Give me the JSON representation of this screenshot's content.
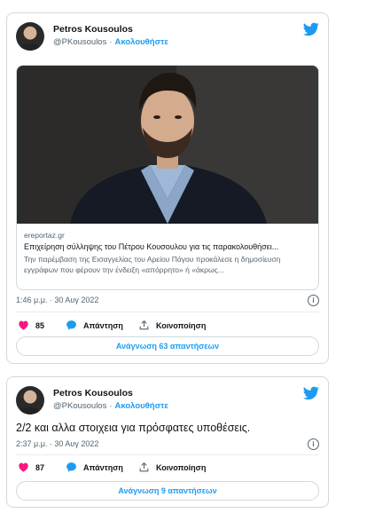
{
  "tweets": [
    {
      "display_name": "Petros Kousoulos",
      "handle": "@PKousoulos",
      "separator": "·",
      "follow_label": "Ακολουθήστε",
      "card": {
        "domain": "ereportaz.gr",
        "title": "Επιχείρηση σύλληψης του Πέτρου Κουσουλου για τις παρακολουθήσει...",
        "description": "Την παρέμβαση της Εισαγγελίας του Αρείου Πάγου προκάλεσε η δημοσίευση εγγράφων που φέρουν την ένδειξη «απόρρητο» ή «άκρως..."
      },
      "timestamp": "1:46 μ.μ. · 30 Αυγ 2022",
      "info_symbol": "i",
      "likes": "85",
      "reply_label": "Απάντηση",
      "share_label": "Κοινοποίηση",
      "read_replies_label": "Ανάγνωση 63 απαντήσεων"
    },
    {
      "display_name": "Petros Kousoulos",
      "handle": "@PKousoulos",
      "separator": "·",
      "follow_label": "Ακολουθήστε",
      "text": "2/2 και αλλα στοιχεια για πρόσφατες υποθέσεις.",
      "timestamp": "2:37 μ.μ. · 30 Αυγ 2022",
      "info_symbol": "i",
      "likes": "87",
      "reply_label": "Απάντηση",
      "share_label": "Κοινοποίηση",
      "read_replies_label": "Ανάγνωση 9 απαντήσεων"
    }
  ],
  "colors": {
    "accent": "#1d9bf0",
    "like": "#f91880",
    "muted": "#536471",
    "border": "#cfd9de"
  },
  "icons": [
    "twitter-bird-icon",
    "heart-icon",
    "comment-icon",
    "share-icon",
    "info-icon"
  ]
}
